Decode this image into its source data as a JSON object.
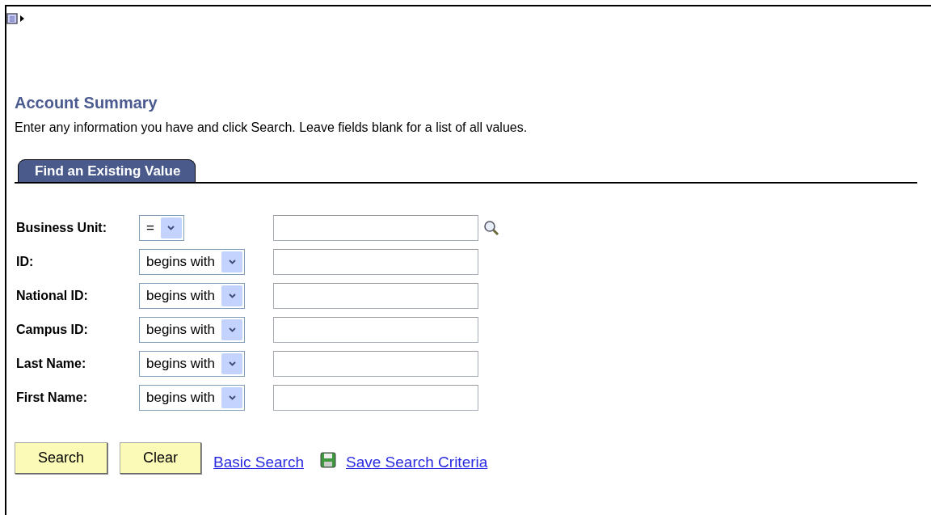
{
  "title": "Account Summary",
  "instructions": "Enter any information you have and click Search. Leave fields blank for a list of all values.",
  "tabs": [
    {
      "label": "Find an Existing Value",
      "selected": true
    }
  ],
  "fields": [
    {
      "label": "Business Unit:",
      "operator": "=",
      "lookup": true
    },
    {
      "label": "ID:",
      "operator": "begins with",
      "lookup": false
    },
    {
      "label": "National ID:",
      "operator": "begins with",
      "lookup": false
    },
    {
      "label": "Campus ID:",
      "operator": "begins with",
      "lookup": false
    },
    {
      "label": "Last Name:",
      "operator": "begins with",
      "lookup": false
    },
    {
      "label": "First Name:",
      "operator": "begins with",
      "lookup": false
    }
  ],
  "buttons": [
    "Search",
    "Clear"
  ],
  "links": [
    {
      "label": "Basic Search",
      "kind": "plain"
    },
    {
      "label": "Save Search Criteria",
      "kind": "save"
    }
  ]
}
